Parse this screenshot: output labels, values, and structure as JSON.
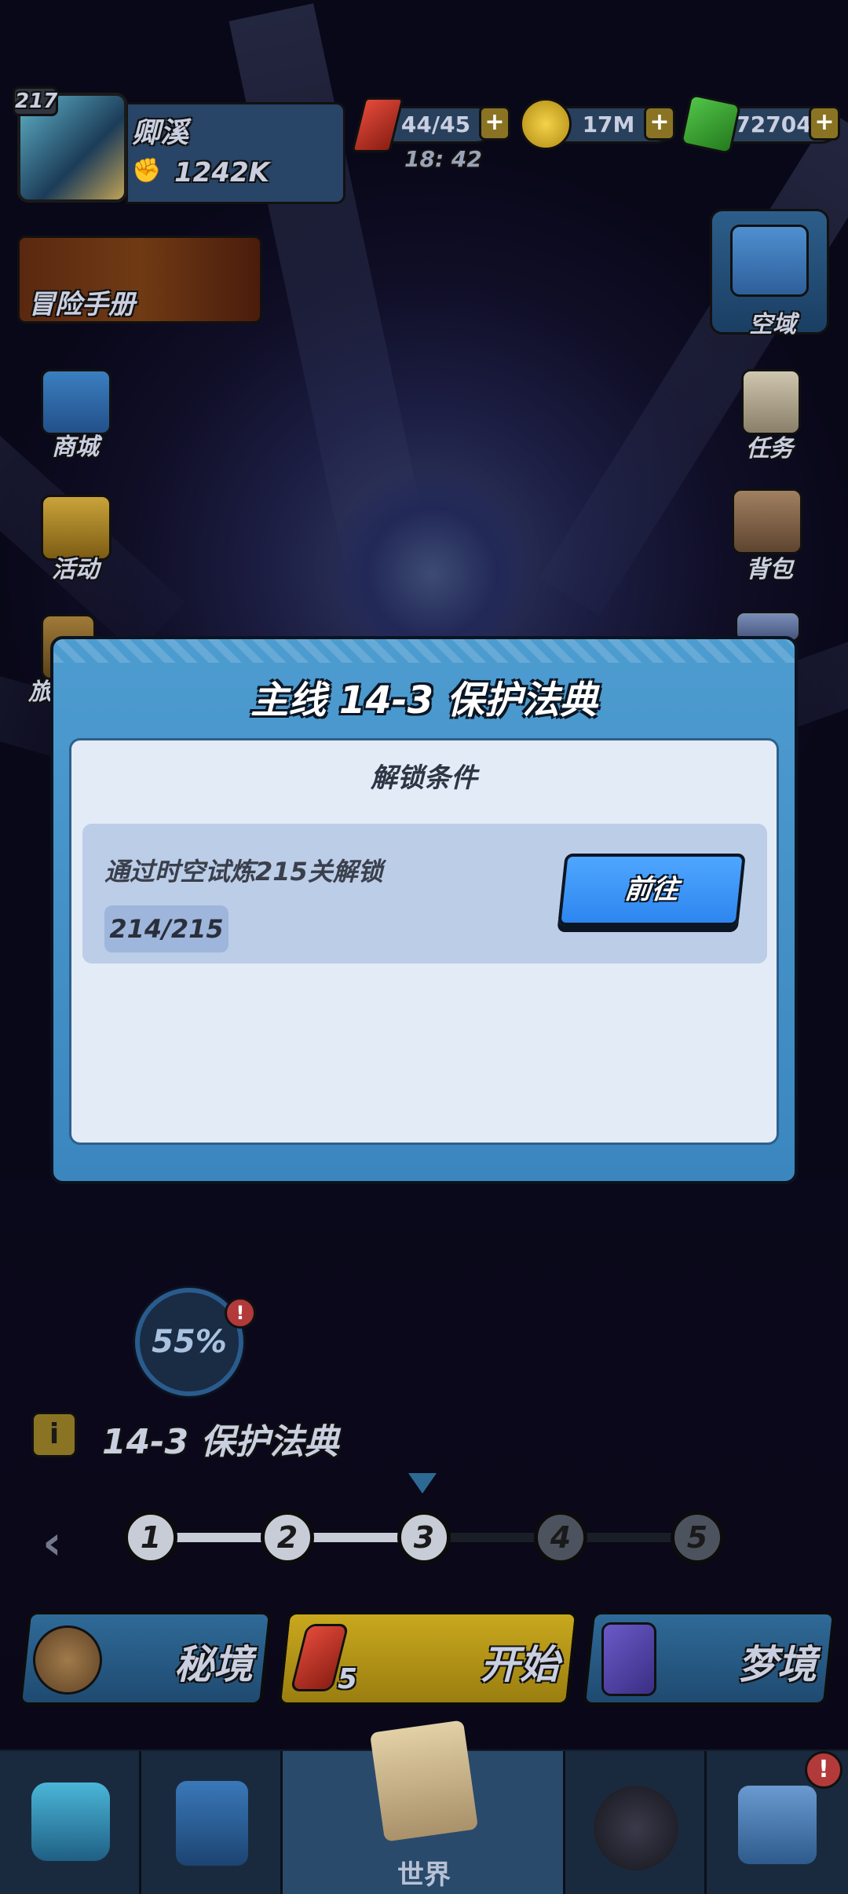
{
  "player": {
    "level": "217",
    "name": "卿溪",
    "power": "1242K"
  },
  "resources": {
    "energy": "44/45",
    "energy_timer": "18: 42",
    "gold": "17M",
    "gems": "72704",
    "plus": "+"
  },
  "left_menu": {
    "handbook": "冒险手册",
    "shop": "商城",
    "events": "活动",
    "partial": "旅"
  },
  "right_menu": {
    "realm": "空域",
    "quests": "任务",
    "bag": "背包"
  },
  "dialog": {
    "title": "主线 14-3 保护法典",
    "section_title": "解锁条件",
    "condition_text": "通过时空试炼215关解锁",
    "condition_progress": "214/215",
    "goto_label": "前往"
  },
  "chapter": {
    "progress_percent": "55%",
    "badge": "!",
    "info_icon": "i",
    "stage_name": "14-3 保护法典",
    "nodes": [
      "1",
      "2",
      "3",
      "4",
      "5"
    ],
    "current_node": 3
  },
  "modes": {
    "secret": "秘境",
    "start": "开始",
    "start_cost": "5",
    "dream": "梦境"
  },
  "tabs": {
    "active_label": "世界",
    "badge": "!"
  },
  "colors": {
    "dialog_blue": "#3b86bf",
    "button_blue": "#2d86ef",
    "gold_yellow": "#c9a81e",
    "alert_red": "#b23a3a"
  }
}
